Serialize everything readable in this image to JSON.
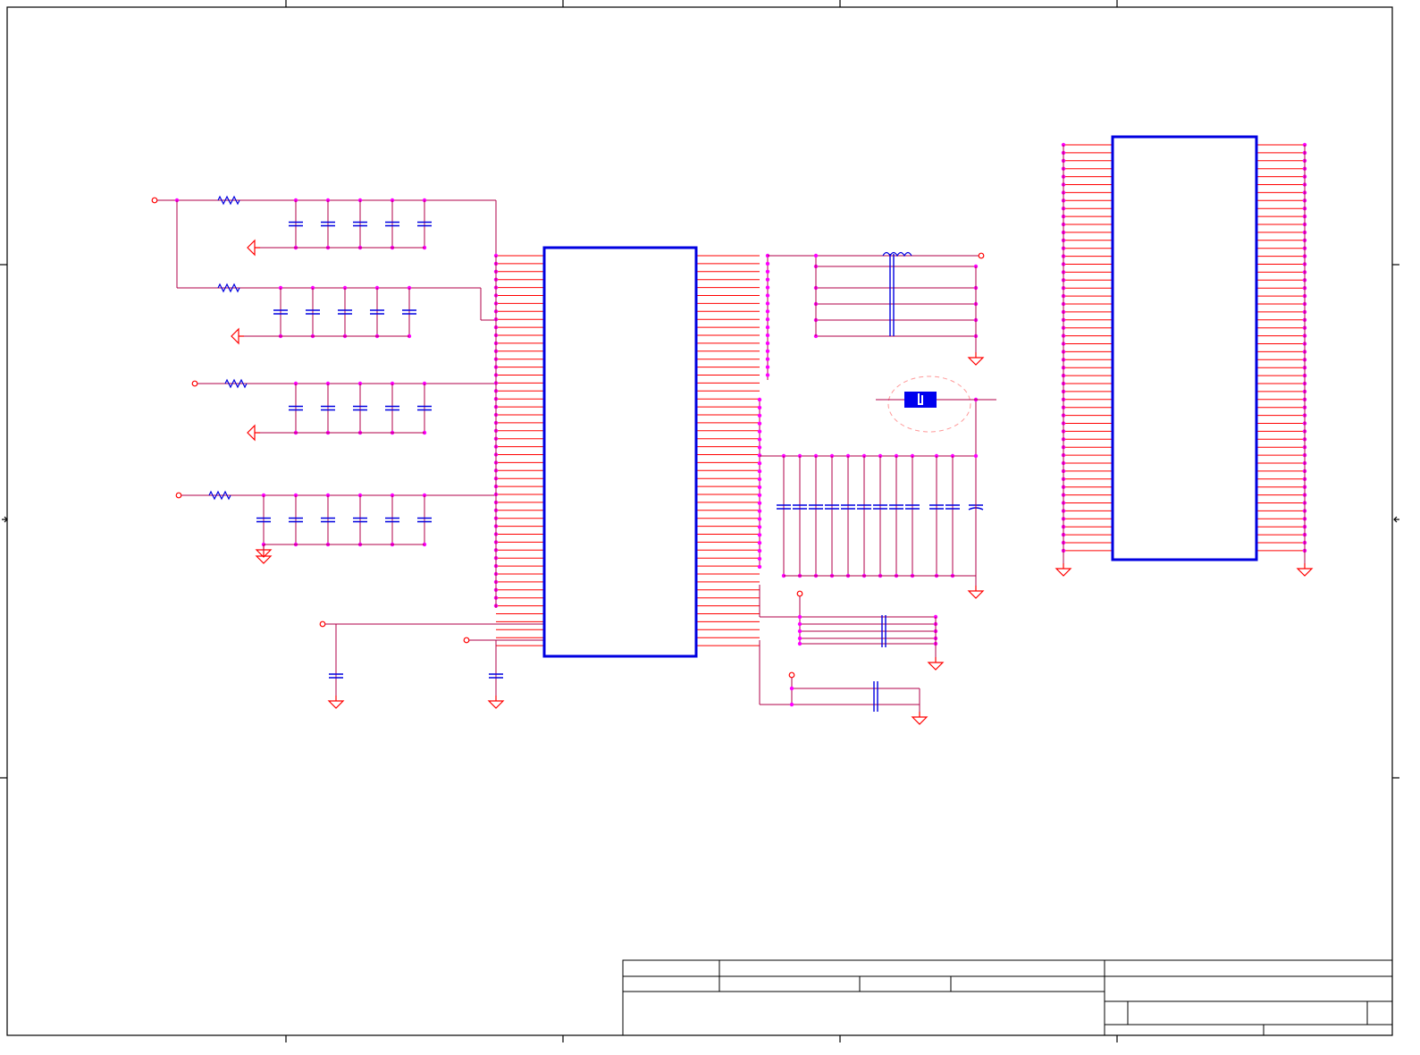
{
  "title_block": {},
  "components": {
    "main_ic": {},
    "connector": {},
    "crystal": {}
  }
}
